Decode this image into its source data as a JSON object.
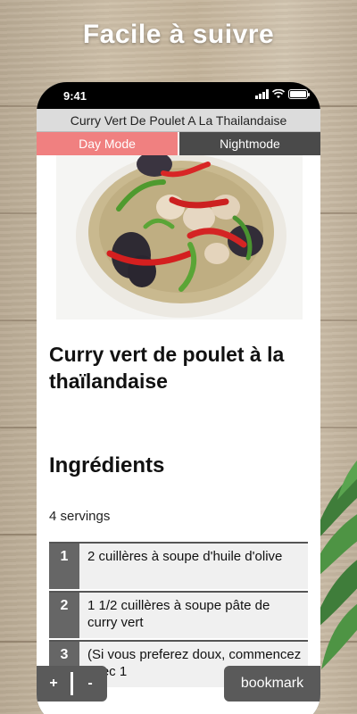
{
  "banner": {
    "text": "Facile à suivre"
  },
  "status_bar": {
    "time": "9:41"
  },
  "app": {
    "title": "Curry Vert De Poulet A La Thailandaise",
    "modes": {
      "day_label": "Day Mode",
      "night_label": "Nightmode"
    }
  },
  "recipe": {
    "title": "Curry vert de poulet à la thaïlandaise",
    "ingredients_heading": "Ingrédients",
    "servings": "4 servings",
    "ingredients": [
      {
        "num": "1",
        "text": "2 cuillères à soupe d'huile d'olive"
      },
      {
        "num": "2",
        "text": "1 1/2 cuillères à soupe pâte de curry vert"
      },
      {
        "num": "3",
        "text": "(Si vous preferez doux, commencez avec 1"
      }
    ]
  },
  "controls": {
    "zoom_in_label": "+",
    "zoom_out_label": "-",
    "bookmark_label": "bookmark"
  },
  "colors": {
    "day_mode_bg": "#f08080",
    "night_mode_bg": "#4a4a4a",
    "control_bg": "#5a5a5a"
  }
}
